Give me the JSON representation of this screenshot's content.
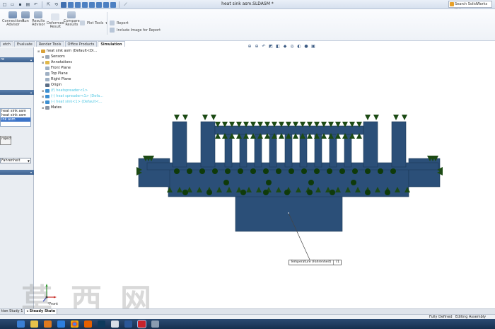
{
  "window": {
    "title": "heat sink asm.SLDASM *",
    "help_search_placeholder": "Search SolidWorks Help"
  },
  "quick_access": [
    "new-icon",
    "open-icon",
    "save-icon",
    "print-icon",
    "undo-icon",
    "select-icon",
    "rebuild-icon",
    "options-icon"
  ],
  "ribbon": {
    "connections_advisor": "Connections\nAdvisor",
    "run": "Run",
    "results_advisor": "Results\nAdvisor",
    "deformed_result": "Deformed\nResult",
    "compare_results": "Compare\nResults",
    "plot_tools": "Plot Tools",
    "report": "Report",
    "include_image": "Include Image for Report"
  },
  "command_tabs": [
    "etch",
    "Evaluate",
    "Render Tools",
    "Office Products",
    "Simulation"
  ],
  "active_command_tab": "Simulation",
  "left_panel": {
    "list_items": [
      "heat sink asm",
      "heat sink asm",
      "ink asm"
    ],
    "selected_index": 2,
    "button_label": "roject",
    "units_value": "Fahrenheit"
  },
  "feature_tree": [
    {
      "label": "heat sink asm  (Default<Di...",
      "icon": "assembly-icon",
      "color": "#d9a23a"
    },
    {
      "label": "Sensors",
      "icon": "sensor-icon",
      "color": "#9aa7b7"
    },
    {
      "label": "Annotations",
      "icon": "annotation-icon",
      "color": "#e0b84a"
    },
    {
      "label": "Front Plane",
      "icon": "plane-icon",
      "color": "#9fb0c4"
    },
    {
      "label": "Top Plane",
      "icon": "plane-icon",
      "color": "#9fb0c4"
    },
    {
      "label": "Right Plane",
      "icon": "plane-icon",
      "color": "#9fb0c4"
    },
    {
      "label": "Origin",
      "icon": "origin-icon",
      "color": "#5a6d85"
    },
    {
      "label": "(f) heatspreader<1>",
      "icon": "part-icon",
      "color": "#3c8fd1",
      "highlight": true
    },
    {
      "label": "(-) heat spreader<1> (Defa...",
      "icon": "part-icon",
      "color": "#3c8fd1",
      "highlight": true
    },
    {
      "label": "(-) heat sink<1> (Default<...",
      "icon": "part-icon",
      "color": "#3c8fd1",
      "highlight": true
    },
    {
      "label": "Mates",
      "icon": "mates-icon",
      "color": "#8a94a3"
    }
  ],
  "view_toolbar": [
    "zoom-fit-icon",
    "zoom-area-icon",
    "previous-view-icon",
    "section-view-icon",
    "view-orientation-icon",
    "display-style-icon",
    "hide-show-icon",
    "edit-appearance-icon",
    "apply-scene-icon",
    "view-settings-icon"
  ],
  "callout": {
    "label": "Temperature (Fahrenheit)",
    "value": "71"
  },
  "triad_label": "*Front",
  "study_tabs": [
    "tion Study 1",
    "Steady State"
  ],
  "status": {
    "fully_defined": "Fully Defined",
    "editing": "Editing Assembly"
  },
  "watermark": {
    "chars": "草西网",
    "url": "zdmox.com"
  },
  "colors": {
    "model_fill": "#2b4f78",
    "model_stroke": "#1d3958",
    "load_arrows": "#1c4a14",
    "fixture": "#0f3a0a"
  },
  "taskbar_apps": [
    "ie-icon",
    "explorer-icon",
    "media-icon",
    "dropbox-icon",
    "chrome-icon",
    "firefox-icon",
    "photoshop-icon",
    "outlook-icon",
    "word-icon",
    "solidworks-icon",
    "app-icon"
  ]
}
